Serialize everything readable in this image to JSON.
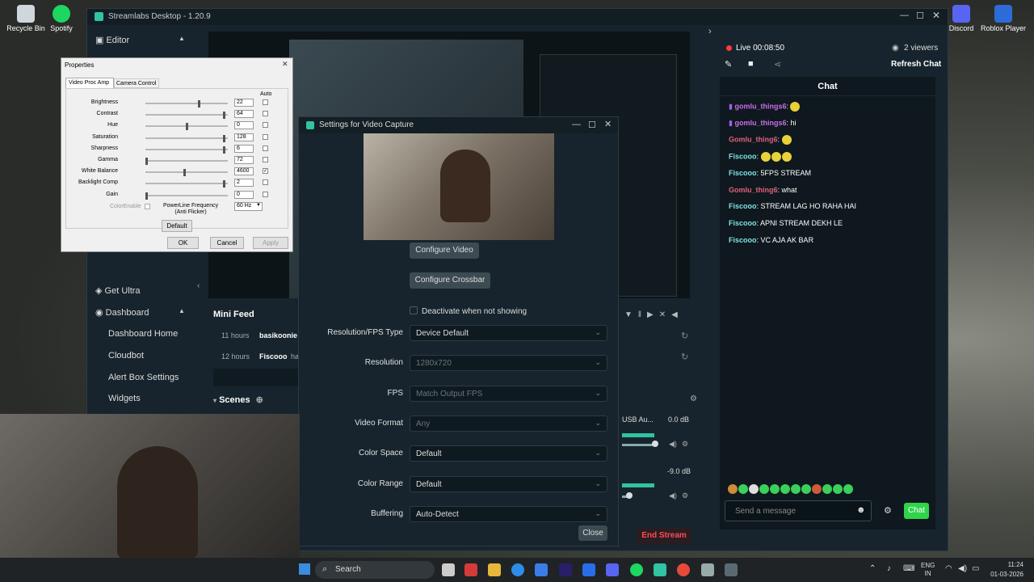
{
  "desktop": {
    "icons": [
      {
        "label": "Recycle Bin",
        "icon": "recycle-bin-icon"
      },
      {
        "label": "Spotify",
        "icon": "spotify-icon"
      },
      {
        "label": "Discord",
        "icon": "discord-icon"
      },
      {
        "label": "Roblox Player",
        "icon": "roblox-icon"
      }
    ]
  },
  "streamlabs": {
    "title": "Streamlabs Desktop - 1.20.9",
    "nav": {
      "editor": "Editor",
      "get_ultra": "Get Ultra",
      "dashboard": "Dashboard",
      "dashboard_items": [
        "Dashboard Home",
        "Cloudbot",
        "Alert Box Settings",
        "Widgets"
      ]
    },
    "mini_feed": {
      "title": "Mini Feed",
      "items": [
        {
          "time": "11 hours",
          "user": "basikoonie"
        },
        {
          "time": "12 hours",
          "user": "Fiscooo",
          "extra": "ha"
        }
      ]
    },
    "scenes_label": "Scenes",
    "mixer": {
      "source1_name": "USB Au...",
      "source1_db": "0.0 dB",
      "source2_db": "-9.0 dB"
    },
    "end_stream": "End Stream",
    "live": {
      "status": "Live 00:08:50",
      "viewers": "2 viewers",
      "refresh_chat": "Refresh Chat"
    },
    "chat": {
      "header": "Chat",
      "messages": [
        {
          "user": "gomlu_things6",
          "text": "",
          "user_color": "#c86ee8",
          "emotes": 1,
          "badge": true
        },
        {
          "user": "gomlu_things6",
          "text": "hi",
          "user_color": "#c86ee8",
          "emotes": 0,
          "badge": true
        },
        {
          "user": "Gomlu_thing6",
          "text": "",
          "user_color": "#e0607a",
          "emotes": 1,
          "badge": false
        },
        {
          "user": "Fiscooo",
          "text": "",
          "user_color": "#7fe0e0",
          "emotes": 3,
          "badge": false
        },
        {
          "user": "Fiscooo",
          "text": "5FPS STREAM",
          "user_color": "#7fe0e0",
          "emotes": 0,
          "badge": false
        },
        {
          "user": "Gomlu_thing6",
          "text": "what",
          "user_color": "#e0607a",
          "emotes": 0,
          "badge": false
        },
        {
          "user": "Fiscooo",
          "text": "STREAM LAG HO RAHA HAI",
          "user_color": "#7fe0e0",
          "emotes": 0,
          "badge": false
        },
        {
          "user": "Fiscooo",
          "text": "APNI STREAM DEKH LE",
          "user_color": "#7fe0e0",
          "emotes": 0,
          "badge": false
        },
        {
          "user": "Fiscooo",
          "text": "VC AJA AK BAR",
          "user_color": "#7fe0e0",
          "emotes": 0,
          "badge": false
        }
      ],
      "placeholder": "Send a message",
      "send_label": "Chat"
    }
  },
  "properties_dialog": {
    "title": "Properties",
    "tabs": [
      "Video Proc Amp",
      "Camera Control"
    ],
    "auto_header": "Auto",
    "rows": [
      {
        "label": "Brightness",
        "value": "22",
        "pos": 0.66,
        "auto": false
      },
      {
        "label": "Contrast",
        "value": "64",
        "pos": 0.97,
        "auto": false
      },
      {
        "label": "Hue",
        "value": "0",
        "pos": 0.5,
        "auto": false
      },
      {
        "label": "Saturation",
        "value": "128",
        "pos": 0.97,
        "auto": false
      },
      {
        "label": "Sharpness",
        "value": "6",
        "pos": 0.97,
        "auto": false
      },
      {
        "label": "Gamma",
        "value": "72",
        "pos": 0.0,
        "auto": false
      },
      {
        "label": "White Balance",
        "value": "4600",
        "pos": 0.47,
        "auto": true
      },
      {
        "label": "Backlight Comp",
        "value": "2",
        "pos": 0.97,
        "auto": false
      },
      {
        "label": "Gain",
        "value": "0",
        "pos": 0.0,
        "auto": false
      }
    ],
    "color_enable": "ColorEnable",
    "powerline_label": "PowerLine Frequency\n(Anti Flicker)",
    "powerline_value": "60 Hz",
    "default_btn": "Default",
    "ok_btn": "OK",
    "cancel_btn": "Cancel",
    "apply_btn": "Apply"
  },
  "video_capture": {
    "title": "Settings for Video Capture",
    "configure_video": "Configure Video",
    "configure_crossbar": "Configure Crossbar",
    "deactivate_label": "Deactivate when not showing",
    "fields": [
      {
        "label": "Resolution/FPS Type",
        "value": "Device Default",
        "disabled": false
      },
      {
        "label": "Resolution",
        "value": "1280x720",
        "disabled": true
      },
      {
        "label": "FPS",
        "value": "Match Output FPS",
        "disabled": true
      },
      {
        "label": "Video Format",
        "value": "Any",
        "disabled": true
      },
      {
        "label": "Color Space",
        "value": "Default",
        "disabled": false
      },
      {
        "label": "Color Range",
        "value": "Default",
        "disabled": false
      },
      {
        "label": "Buffering",
        "value": "Auto-Detect",
        "disabled": false
      }
    ],
    "close_btn": "Close"
  },
  "taskbar": {
    "search": "Search",
    "lang": "ENG\nIN",
    "time": "11:24",
    "date": "01-03-2026"
  }
}
